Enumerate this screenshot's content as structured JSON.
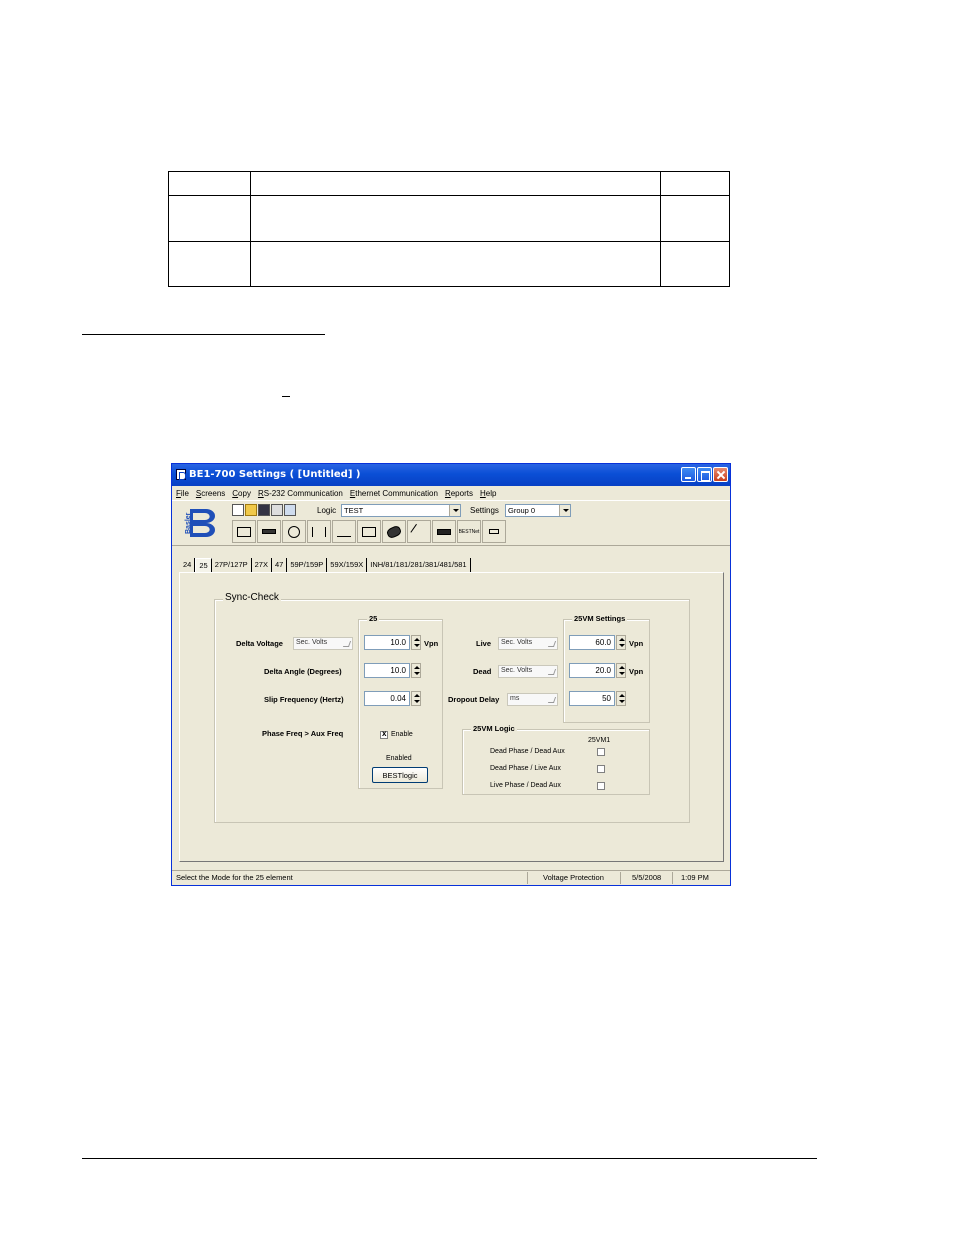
{
  "window": {
    "title": "BE1-700 Settings   ( [Untitled] )"
  },
  "menu": [
    "File",
    "Screens",
    "Copy",
    "RS-232 Communication",
    "Ethernet Communication",
    "Reports",
    "Help"
  ],
  "toolbar": {
    "logo_text": "Basler",
    "logic_label": "Logic",
    "logic_value": "TEST",
    "settings_label": "Settings",
    "settings_value": "Group 0",
    "bestnet_label": "BESTNet"
  },
  "tabs": [
    "24",
    "25",
    "27P/127P",
    "27X",
    "47",
    "59P/159P",
    "59X/159X",
    "INH/81/181/281/381/481/581"
  ],
  "active_tab": "25",
  "sync_check": {
    "title": "Sync-Check",
    "group25_title": "25",
    "delta_voltage_label": "Delta Voltage",
    "delta_voltage_mode": "Sec. Volts",
    "delta_voltage_value": "10.0",
    "delta_voltage_unit": "Vpn",
    "delta_angle_label": "Delta Angle (Degrees)",
    "delta_angle_value": "10.0",
    "slip_freq_label": "Slip Frequency (Hertz)",
    "slip_freq_value": "0.04",
    "phase_freq_label": "Phase Freq > Aux Freq",
    "enable_label": "Enable",
    "enable_checked": true,
    "enabled_text": "Enabled",
    "bestlogic_button": "BESTlogic"
  },
  "vm25": {
    "title": "25VM Settings",
    "live_label": "Live",
    "live_mode": "Sec. Volts",
    "live_value": "60.0",
    "live_unit": "Vpn",
    "dead_label": "Dead",
    "dead_mode": "Sec. Volts",
    "dead_value": "20.0",
    "dead_unit": "Vpn",
    "dropout_label": "Dropout Delay",
    "dropout_mode": "ms",
    "dropout_value": "50"
  },
  "vm25_logic": {
    "title": "25VM Logic",
    "column_header": "25VM1",
    "rows": [
      "Dead Phase / Dead Aux",
      "Dead Phase / Live Aux",
      "Live Phase / Dead Aux"
    ]
  },
  "status": {
    "hint": "Select the Mode for the 25 element",
    "section": "Voltage Protection",
    "date": "5/5/2008",
    "time": "1:09 PM"
  }
}
